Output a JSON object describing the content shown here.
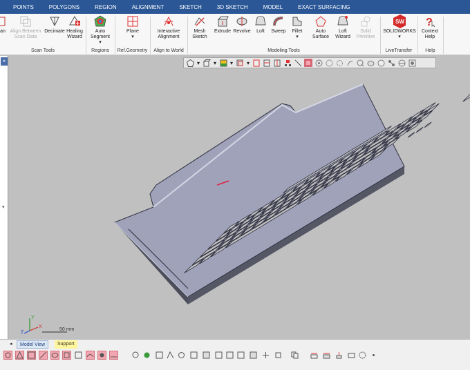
{
  "tabs": [
    "POINTS",
    "POLYGONS",
    "REGION",
    "ALIGNMENT",
    "SKETCH",
    "3D SKETCH",
    "MODEL",
    "EXACT SURFACING"
  ],
  "ribbon": {
    "buttons": {
      "scan": "an",
      "align_between": "Align Between Scan Data",
      "decimate": "Decimate",
      "healing_wizard": "Healing Wizard",
      "auto_segment": "Auto Segment",
      "plane": "Plane",
      "interactive_alignment": "Interactive Alignment",
      "mesh_sketch": "Mesh Sketch",
      "extrude": "Extrude",
      "revolve": "Revolve",
      "loft": "Loft",
      "sweep": "Sweep",
      "fillet": "Fillet",
      "auto_surface": "Auto Surface",
      "loft_wizard": "Loft Wizard",
      "solid_primitive": "Solid Primitive",
      "solidworks": "SOLIDWORKS",
      "context_help": "Context Help"
    },
    "groups": {
      "scan_tools": "Scan Tools",
      "regions": "Regions",
      "ref_geometry": "Ref.Geometry",
      "align_to_world": "Align to World",
      "modeling_tools": "Modeling Tools",
      "livetransfer": "LiveTransfer",
      "help": "Help"
    }
  },
  "viewport": {
    "axis_labels": {
      "x": "X",
      "y": "Y",
      "z": "Z"
    },
    "scale_label": "50 mm"
  },
  "bottom_tabs": {
    "model_view": "Model View",
    "support": "Support"
  },
  "colors": {
    "accent": "#2b5797",
    "viewport_bg": "#c0c0c0",
    "model_fill": "#9b9eb8",
    "key_hole": "#c0c0c0",
    "highlight": "#e02040"
  }
}
